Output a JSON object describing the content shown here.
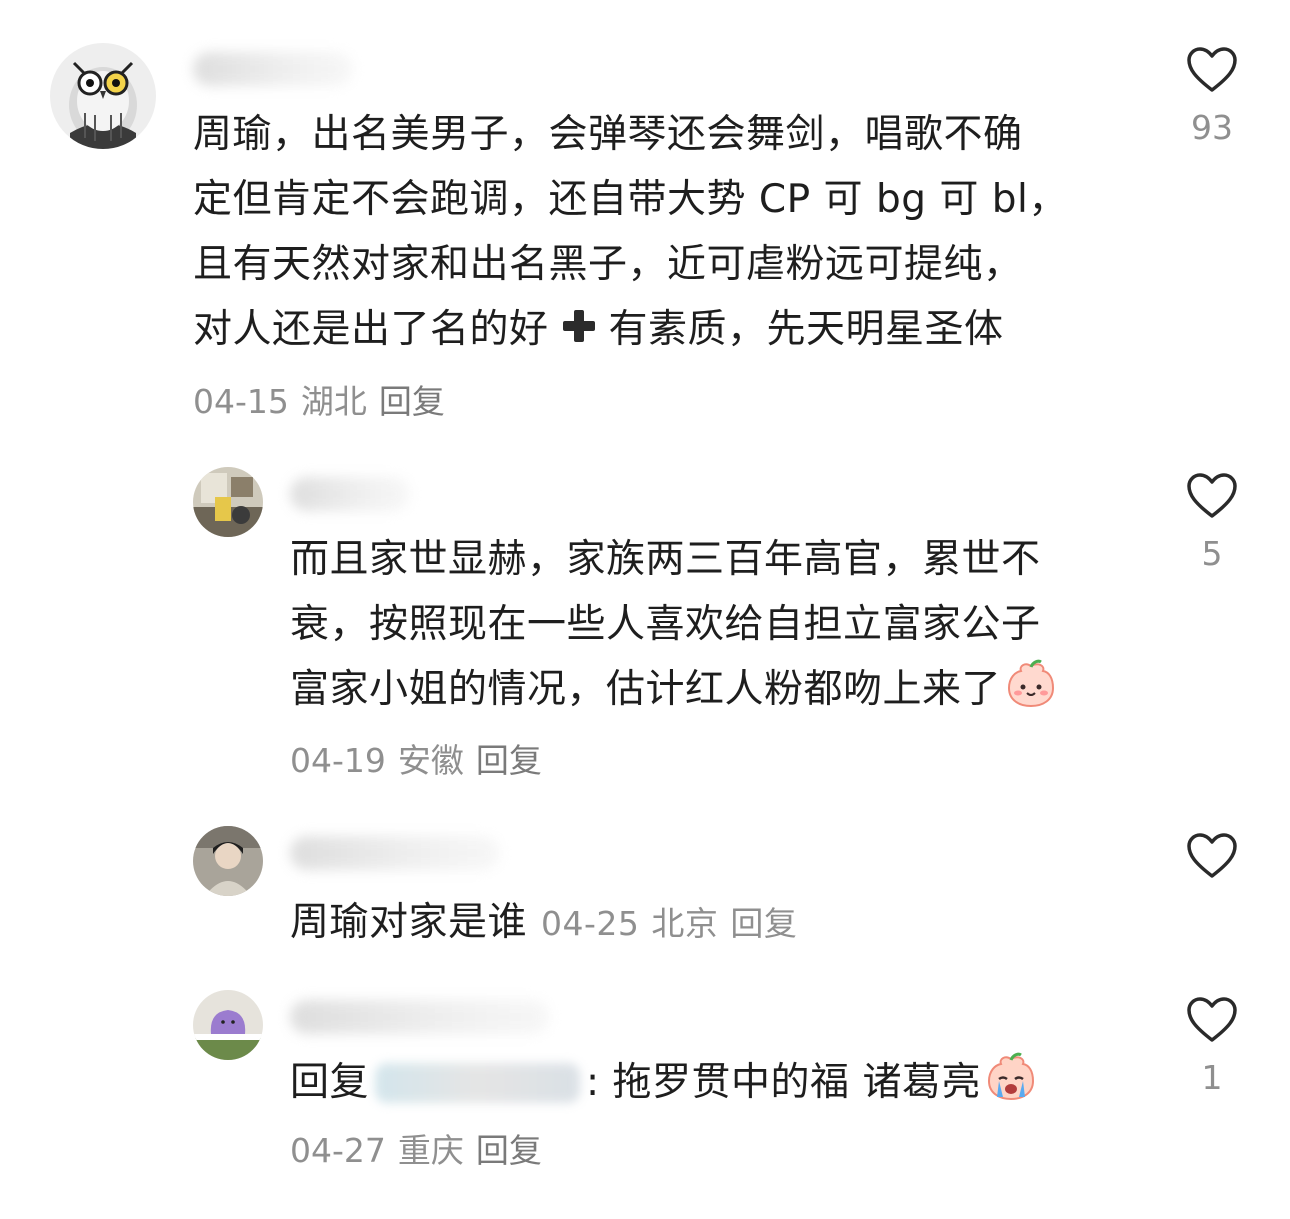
{
  "comments": [
    {
      "body_lines": [
        "周瑜，出名美男子，会弹琴还会舞剑，唱歌不确",
        "定但肯定不会跑调，还自带大势 CP 可 bg 可 bl，",
        "且有天然对家和出名黑子，近可虐粉远可提纯，",
        "对人还是出了名的好",
        "有素质，先天明星圣体"
      ],
      "date": "04-15",
      "location": "湖北",
      "reply_label": "回复",
      "likes": "93"
    },
    {
      "body_lines": [
        "而且家世显赫，家族两三百年高官，累世不",
        "衰，按照现在一些人喜欢给自担立富家公子",
        "富家小姐的情况，估计红人粉都吻上来了"
      ],
      "date": "04-19",
      "location": "安徽",
      "reply_label": "回复",
      "likes": "5"
    },
    {
      "body": "周瑜对家是谁",
      "date": "04-25",
      "location": "北京",
      "reply_label": "回复",
      "likes": ""
    },
    {
      "reply_prefix": "回复",
      "body_after": ": 拖罗贯中的福 诸葛亮",
      "date": "04-27",
      "location": "重庆",
      "reply_label": "回复",
      "likes": "1"
    }
  ],
  "icons": {
    "like": "heart-outline-icon",
    "plus": "heavy-plus-icon",
    "emoji_smile": "peach-smile-emoji",
    "emoji_cry": "peach-cry-emoji"
  },
  "colors": {
    "text": "#1e1e1e",
    "meta": "#8f8f8f",
    "heart_stroke": "#2a2a2a"
  }
}
